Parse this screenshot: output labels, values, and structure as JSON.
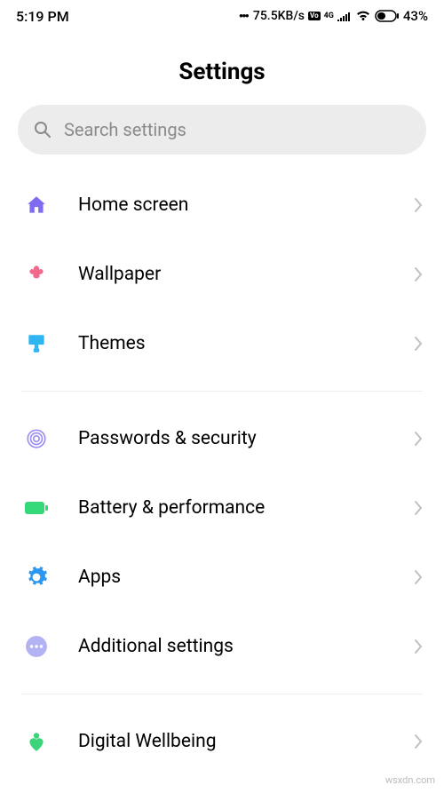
{
  "status": {
    "time": "5:19 PM",
    "network_speed": "75.5KB/s",
    "battery_percent": "43%",
    "volte": "4G"
  },
  "page": {
    "title": "Settings"
  },
  "search": {
    "placeholder": "Search settings"
  },
  "items": {
    "home_screen": {
      "label": "Home screen",
      "color": "#7d6cf0"
    },
    "wallpaper": {
      "label": "Wallpaper",
      "color": "#f16a8b"
    },
    "themes": {
      "label": "Themes",
      "color": "#2fb5f2"
    },
    "passwords": {
      "label": "Passwords & security",
      "color": "#9a8df3"
    },
    "battery": {
      "label": "Battery & performance",
      "color": "#35d97a"
    },
    "apps": {
      "label": "Apps",
      "color": "#2b97f0"
    },
    "additional": {
      "label": "Additional settings",
      "color": "#b2b2f4"
    },
    "wellbeing": {
      "label": "Digital Wellbeing",
      "color": "#3bd47a"
    }
  },
  "watermark": "wsxdn.com"
}
